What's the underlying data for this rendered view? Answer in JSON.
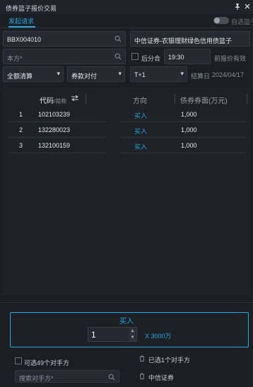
{
  "window": {
    "title": "债券篮子报价交易",
    "pin_icon": "pin-icon",
    "close_icon": "close-icon"
  },
  "tabs": [
    {
      "label": "发起请求",
      "active": true
    }
  ],
  "auto_basket": {
    "label": "自选篮子",
    "enabled": false
  },
  "form": {
    "code_input": "BBX004010",
    "counterparty_select": "中信证券-农银理财绿色信用债篮子",
    "our_side_placeholder": "本方*",
    "after_split_label": "后分合",
    "time_value": "19:30",
    "before_quote_label": "前报价有效",
    "settlement_type": "全额清算",
    "delivery_type": "券款对付",
    "settle_speed": "T+1",
    "settle_date_label": "结算日",
    "settle_date": "2024/04/17"
  },
  "table": {
    "headers": {
      "code": "代码",
      "code_sub": "/简称",
      "direction": "方向",
      "face_value": "债券券面(万元)"
    },
    "rows": [
      {
        "index": "1",
        "code": "102103239",
        "direction": "买入",
        "face_value": "1,000"
      },
      {
        "index": "2",
        "code": "132280023",
        "direction": "买入",
        "face_value": "1,000"
      },
      {
        "index": "3",
        "code": "132100159",
        "direction": "买入",
        "face_value": "1,000"
      }
    ]
  },
  "order": {
    "title": "买入",
    "quantity": "1",
    "unit_text": "X 3000万"
  },
  "counterparty": {
    "selectable_label": "可选49个对手方",
    "search_placeholder": "搜索对手方*",
    "selected_label": "已选1个对手方",
    "selected_items": [
      "中信证券"
    ]
  },
  "colors": {
    "accent": "#23a8de",
    "background": "#1b1e23",
    "panel": "#1e2126"
  }
}
